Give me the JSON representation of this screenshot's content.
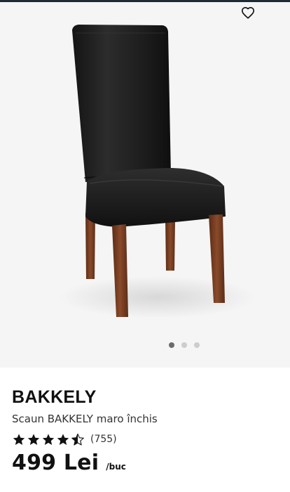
{
  "gallery": {
    "wishlist_icon": "heart-outline-icon",
    "slide_count": 3,
    "active_slide": 1,
    "background_color": "#f5f5f5"
  },
  "product": {
    "name": "BAKKELY",
    "description": "Scaun BAKKELY maro închis",
    "rating": {
      "stars": 4.5,
      "max_stars": 5,
      "count_text": "(755)"
    },
    "price": "499 Lei",
    "unit": "/buc"
  },
  "colors": {
    "text": "#111111",
    "dot_active": "#6b6b6b",
    "dot_inactive": "#cdcdcd",
    "top_strip": "#1e2a35"
  }
}
